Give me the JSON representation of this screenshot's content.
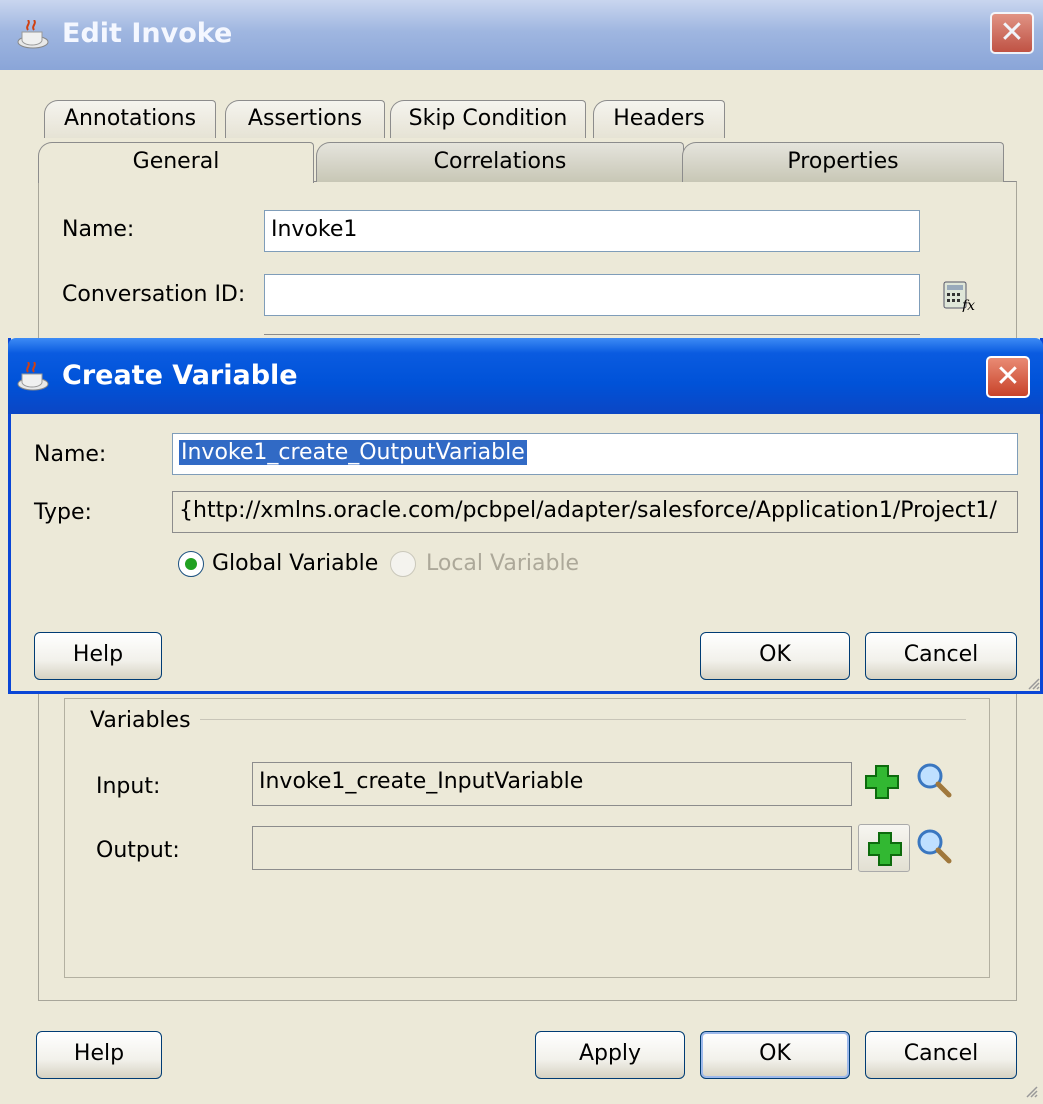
{
  "edit_invoke": {
    "title": "Edit Invoke",
    "tabs_back": [
      "Annotations",
      "Assertions",
      "Skip Condition",
      "Headers"
    ],
    "tabs_front": [
      "General",
      "Correlations",
      "Properties"
    ],
    "name_label": "Name:",
    "name_value": "Invoke1",
    "conversation_label": "Conversation ID:",
    "conversation_value": "",
    "variables": {
      "group_title": "Variables",
      "input_label": "Input:",
      "input_value": "Invoke1_create_InputVariable",
      "output_label": "Output:",
      "output_value": ""
    },
    "buttons": {
      "help": "Help",
      "apply": "Apply",
      "ok": "OK",
      "cancel": "Cancel"
    }
  },
  "create_variable": {
    "title": "Create Variable",
    "name_label": "Name:",
    "name_value": "Invoke1_create_OutputVariable",
    "type_label": "Type:",
    "type_value": "{http://xmlns.oracle.com/pcbpel/adapter/salesforce/Application1/Project1/",
    "radio_global": "Global Variable",
    "radio_local": "Local Variable",
    "global_selected": true,
    "buttons": {
      "help": "Help",
      "ok": "OK",
      "cancel": "Cancel"
    }
  },
  "icons": {
    "app": "coffee-cup-icon",
    "close": "close-icon",
    "expression_builder": "expression-builder-icon",
    "add": "green-plus-icon",
    "browse": "magnifier-icon"
  }
}
